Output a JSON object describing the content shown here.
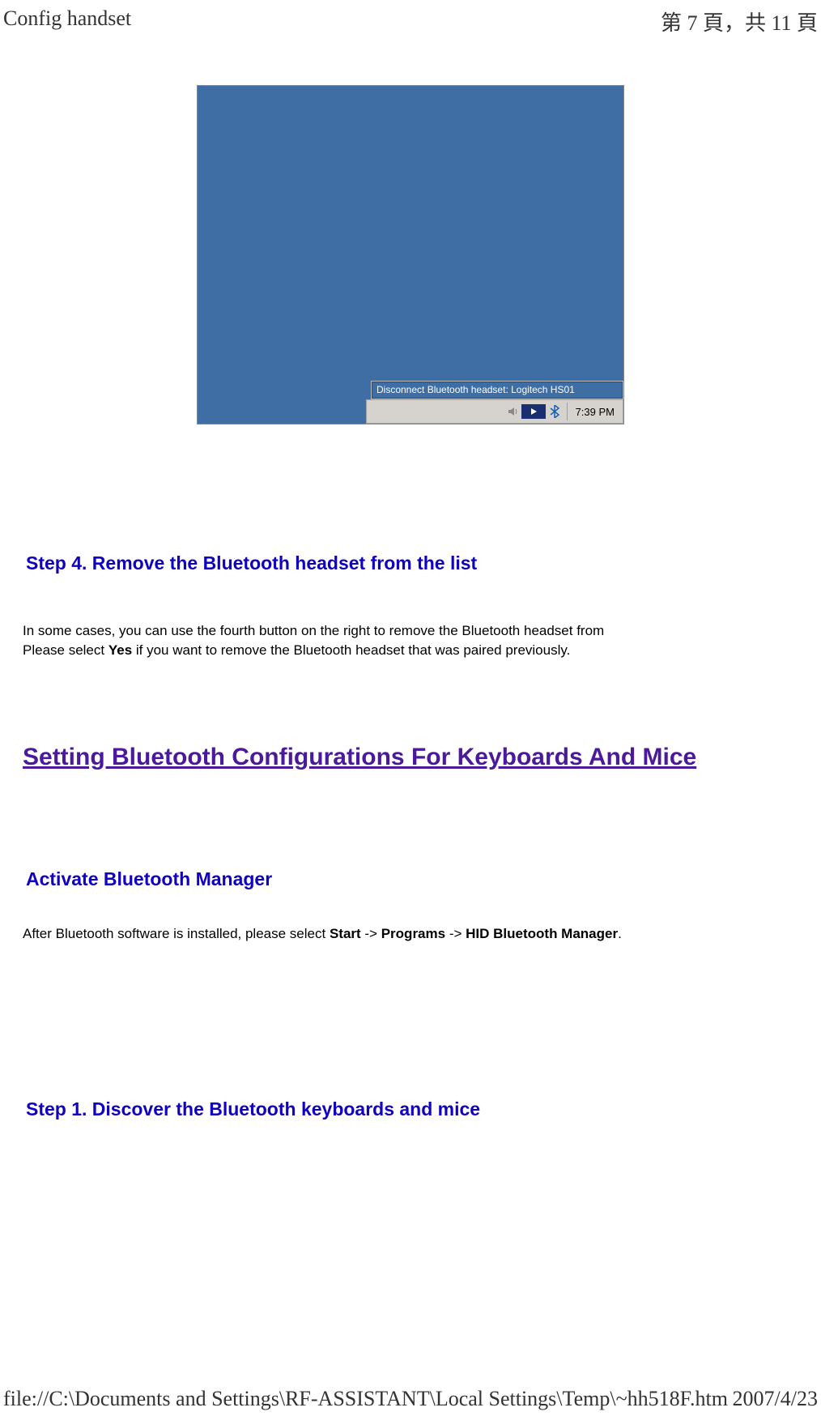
{
  "header": {
    "title": "Config handset",
    "page_info": "第 7 頁，共 11 頁"
  },
  "screenshot": {
    "tooltip_text": "Disconnect Bluetooth headset: Logitech HS01",
    "clock": "7:39 PM",
    "icons": {
      "volume": "volume-icon",
      "play": "play-icon",
      "bluetooth": "bluetooth-icon"
    }
  },
  "step4": {
    "heading": "Step 4. Remove the Bluetooth headset from the list",
    "line1_pre": "In some cases, you can use the fourth button on the right to remove the Bluetooth headset from",
    "line2_pre": "Please select ",
    "line2_bold": "Yes",
    "line2_post": " if you want to remove the Bluetooth headset that was paired previously."
  },
  "section": {
    "link_text": "Setting Bluetooth Configurations For Keyboards And Mice"
  },
  "activate": {
    "heading": "Activate Bluetooth Manager",
    "body_pre": "After Bluetooth software is installed, please select ",
    "b1": "Start",
    "arrow": " -> ",
    "b2": "Programs",
    "b3": "HID Bluetooth Manager",
    "body_post": "."
  },
  "step1": {
    "heading": "Step 1. Discover the Bluetooth keyboards and mice"
  },
  "footer": {
    "path": "file://C:\\Documents and Settings\\RF-ASSISTANT\\Local Settings\\Temp\\~hh518F.htm",
    "date": "2007/4/23"
  }
}
